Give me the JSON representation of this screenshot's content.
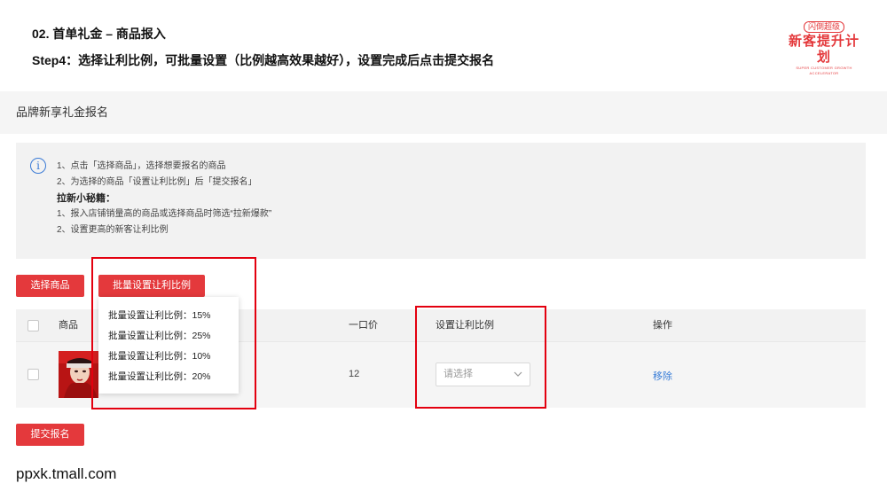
{
  "slide": {
    "title": "02. 首单礼金 – 商品报入",
    "step": "Step4：选择让利比例，可批量设置（比例越高效果越好），设置完成后点击提交报名"
  },
  "brand": {
    "badge": "闪倒超级",
    "name": "新客提升计划",
    "tagline": "SUPER CUSTOMER GROWTH ACCELERATOR",
    "color": "#e4393c"
  },
  "panel": {
    "title": "品牌新享礼金报名"
  },
  "notice": {
    "icon": "info-icon",
    "lines": [
      "1、点击「选择商品」，选择想要报名的商品",
      "2、为选择的商品「设置让利比例」后「提交报名」",
      "拉新小秘籍：",
      "1、报入店铺销量高的商品或选择商品时筛选“拉新爆款”",
      "2、设置更高的新客让利比例"
    ]
  },
  "buttons": {
    "select_product": "选择商品",
    "batch_set": "批量设置让利比例",
    "submit": "提交报名"
  },
  "dropdown": {
    "options": [
      "批量设置让利比例：15%",
      "批量设置让利比例：25%",
      "批量设置让利比例：10%",
      "批量设置让利比例：20%"
    ]
  },
  "table": {
    "headers": {
      "product": "商品",
      "price": "一口价",
      "ratio": "设置让利比例",
      "action": "操作"
    },
    "rows": [
      {
        "price": "12",
        "ratio_placeholder": "请选择",
        "action": "移除"
      }
    ]
  },
  "footer": {
    "url": "ppxk.tmall.com"
  },
  "colors": {
    "primary_red": "#e4393c",
    "highlight_border": "#e3000f",
    "link_blue": "#3a7ed8",
    "info_blue": "#3b7bd6"
  }
}
